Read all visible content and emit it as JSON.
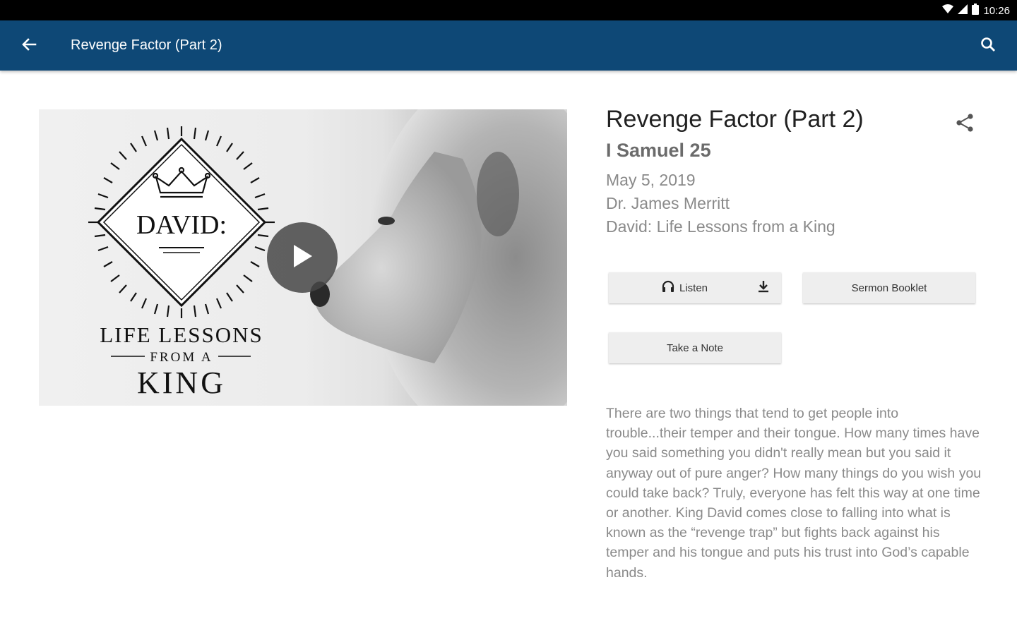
{
  "status_bar": {
    "time": "10:26",
    "icons": [
      "wifi-icon",
      "signal-icon",
      "battery-icon"
    ]
  },
  "app_bar": {
    "title": "Revenge Factor (Part 2)",
    "back_icon": "arrow-back-icon",
    "search_icon": "search-icon",
    "color": "#0e4876"
  },
  "artwork": {
    "title": "DAVID:",
    "line1": "LIFE LESSONS",
    "line2": "FROM A",
    "line3": "KING",
    "play_icon": "play-icon"
  },
  "sermon": {
    "title": "Revenge Factor (Part 2)",
    "scripture": "I Samuel 25",
    "date": "May 5, 2019",
    "speaker": "Dr. James Merritt",
    "series": "David: Life Lessons from a King",
    "share_icon": "share-icon"
  },
  "actions": {
    "listen_label": "Listen",
    "listen_icon": "headphones-icon",
    "download_icon": "download-icon",
    "booklet_label": "Sermon Booklet",
    "note_label": "Take a Note"
  },
  "description": "There are two things that tend to get people into trouble...their temper and their tongue. How many times have you said something you didn't really mean but you said it anyway out of pure anger? How many things do you wish you could take back? Truly, everyone has felt this way at one time or another. King David comes close to falling into what is known as the “revenge trap” but fights back against his temper and his tongue and puts his trust into God’s capable hands."
}
